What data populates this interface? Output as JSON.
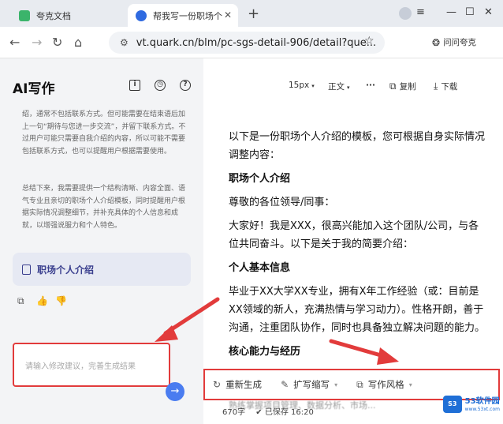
{
  "browser": {
    "tabs": [
      {
        "title": "夸克文档",
        "active": false,
        "favicon_color": "#3bb46b"
      },
      {
        "title": "帮我写一份职场个",
        "active": true,
        "favicon_color": "#2f6ae0"
      }
    ],
    "url": "vt.quark.cn/blm/pc-sgs-detail-906/detail?que...",
    "ask_label": "问问夸克"
  },
  "left_panel": {
    "title": "AI写作",
    "para1": "绍，通常不包括联系方式。但可能需要在结束语后加上一句“期待与您进一步交流”，并留下联系方式。不过用户可能只需要自我介绍的内容，所以可能不需要包括联系方式，也可以提醒用户根据需要使用。",
    "para2": "总结下来，我需要提供一个结构清晰、内容全面、语气专业且亲切的职场个人介绍模板，同时提醒用户根据实际情况调整细节，并补充具体的个人信息和成就，以增强说服力和个人特色。",
    "doc_card_label": "职场个人介绍",
    "input_placeholder": "请输入修改建议，完善生成结果"
  },
  "toolbar": {
    "font_size": "15px",
    "paragraph": "正文",
    "more": "···",
    "copy": "复制",
    "download": "下载"
  },
  "document": {
    "intro": "以下是一份职场个人介绍的模板，您可根据自身实际情况调整内容：",
    "heading1": "职场个人介绍",
    "greeting": "尊敬的各位领导/同事：",
    "opening": "大家好！我是XXX，很高兴能加入这个团队/公司，与各位共同奋斗。以下是关于我的简要介绍：",
    "heading2": "个人基本信息",
    "basic_info": "毕业于XX大学XX专业，拥有X年工作经验（或：目前是XX领域的新人，充满热情与学习动力）。性格开朗，善于沟通，注重团队协作，同时也具备独立解决问题的能力。",
    "heading3": "核心能力与经历",
    "overflow": "熟练掌握项目管理、数据分析、市场..."
  },
  "action_bar": {
    "regenerate": "重新生成",
    "expand": "扩写缩写",
    "style": "写作风格"
  },
  "status": {
    "word_count": "670字",
    "saved": "已保存 16:20"
  },
  "watermark": {
    "logo": "S3",
    "name": "53软件园",
    "site": "www.53xt.com"
  }
}
